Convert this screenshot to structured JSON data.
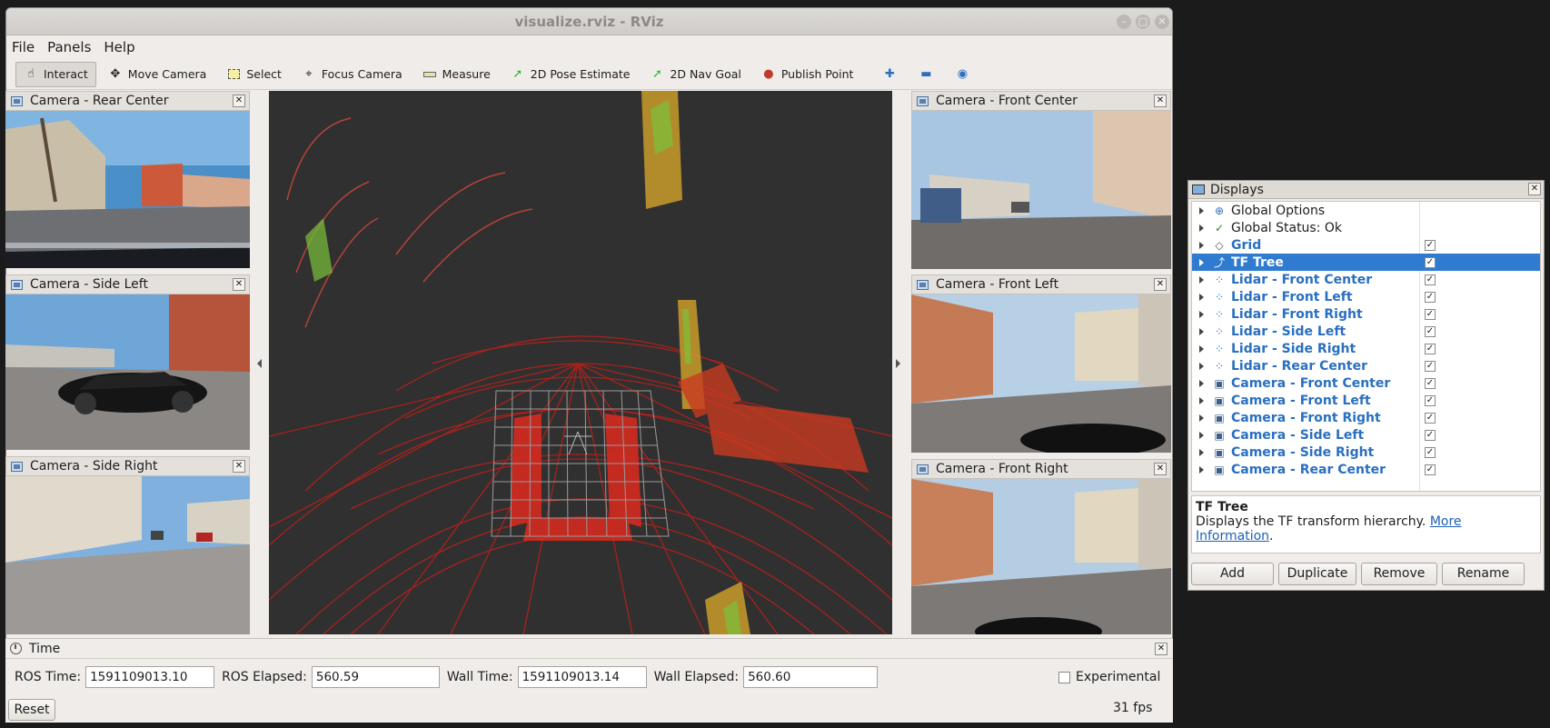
{
  "window": {
    "title": "visualize.rviz - RViz"
  },
  "menu": [
    "File",
    "Panels",
    "Help"
  ],
  "toolbar": {
    "interact": "Interact",
    "move_camera": "Move Camera",
    "select": "Select",
    "focus_camera": "Focus Camera",
    "measure": "Measure",
    "pose_estimate": "2D Pose Estimate",
    "nav_goal": "2D Nav Goal",
    "publish_point": "Publish Point"
  },
  "left_panels": [
    "Camera - Rear Center",
    "Camera - Side Left",
    "Camera - Side Right"
  ],
  "right_panels": [
    "Camera - Front Center",
    "Camera - Front Left",
    "Camera - Front Right"
  ],
  "time": {
    "title": "Time",
    "ros_time_label": "ROS Time:",
    "ros_time": "1591109013.10",
    "ros_elapsed_label": "ROS Elapsed:",
    "ros_elapsed": "560.59",
    "wall_time_label": "Wall Time:",
    "wall_time": "1591109013.14",
    "wall_elapsed_label": "Wall Elapsed:",
    "wall_elapsed": "560.60",
    "experimental": "Experimental",
    "reset": "Reset",
    "fps": "31 fps"
  },
  "displays": {
    "title": "Displays",
    "items": [
      {
        "label": "Global Options",
        "icon": "globe-icon",
        "blue": false,
        "check": false
      },
      {
        "label": "Global Status: Ok",
        "icon": "checkmark-icon",
        "blue": false,
        "check": false
      },
      {
        "label": "Grid",
        "icon": "grid-icon",
        "blue": true,
        "check": true
      },
      {
        "label": "TF Tree",
        "icon": "tf-icon",
        "blue": true,
        "check": true,
        "selected": true
      },
      {
        "label": "Lidar - Front Center",
        "icon": "pointcloud-icon",
        "blue": true,
        "check": true
      },
      {
        "label": "Lidar - Front Left",
        "icon": "pointcloud-icon",
        "blue": true,
        "check": true
      },
      {
        "label": "Lidar - Front Right",
        "icon": "pointcloud-icon",
        "blue": true,
        "check": true
      },
      {
        "label": "Lidar - Side Left",
        "icon": "pointcloud-icon",
        "blue": true,
        "check": true
      },
      {
        "label": "Lidar - Side Right",
        "icon": "pointcloud-icon",
        "blue": true,
        "check": true
      },
      {
        "label": "Lidar - Rear Center",
        "icon": "pointcloud-icon",
        "blue": true,
        "check": true
      },
      {
        "label": "Camera - Front Center",
        "icon": "camera-icon",
        "blue": true,
        "check": true
      },
      {
        "label": "Camera - Front Left",
        "icon": "camera-icon",
        "blue": true,
        "check": true
      },
      {
        "label": "Camera - Front Right",
        "icon": "camera-icon",
        "blue": true,
        "check": true
      },
      {
        "label": "Camera - Side Left",
        "icon": "camera-icon",
        "blue": true,
        "check": true
      },
      {
        "label": "Camera - Side Right",
        "icon": "camera-icon",
        "blue": true,
        "check": true
      },
      {
        "label": "Camera - Rear Center",
        "icon": "camera-icon",
        "blue": true,
        "check": true
      }
    ],
    "desc_title": "TF Tree",
    "desc_text": "Displays the TF transform hierarchy.",
    "desc_link": "More Information",
    "buttons": [
      "Add",
      "Duplicate",
      "Remove",
      "Rename"
    ]
  }
}
